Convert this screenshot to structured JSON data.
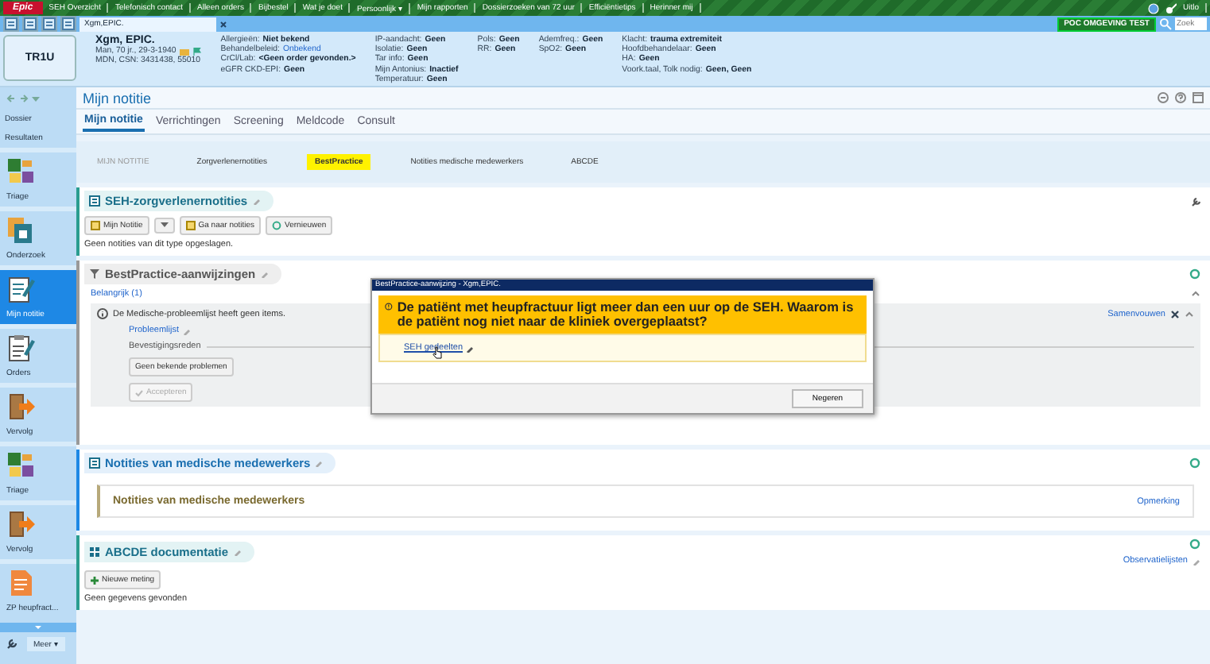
{
  "toolbar": {
    "logo": "Epic",
    "items": [
      "SEH Overzicht",
      "Telefonisch contact",
      "Alleen orders",
      "Bijbestel",
      "Wat je doet",
      "Persoonlijk ▾",
      "Mijn rapporten",
      "Dossierzoeken van 72 uur",
      "Efficiëntietips",
      "Herinner mij"
    ],
    "logout": "Uitlo"
  },
  "tabstrip": {
    "tabs": [
      {
        "label": "Xgm,EPIC.",
        "selected": true
      }
    ],
    "environment": "POC OMGEVING TEST",
    "search_placeholder": "Zoek"
  },
  "patient": {
    "bed": "TR1U",
    "name": "Xgm, EPIC.",
    "demographics": "Man, 70 jr., 29-3-1940",
    "ids": "MDN, CSN: 3431438, 55010",
    "columns": [
      [
        {
          "label": "Allergieën:",
          "value": "Niet bekend",
          "kind": "plain"
        },
        {
          "label": "Behandelbeleid:",
          "value": "Onbekend",
          "kind": "link"
        },
        {
          "label": "CrCl/Lab:",
          "value": "<Geen order gevonden.>",
          "kind": "plain"
        },
        {
          "label": "eGFR CKD-EPI:",
          "value": "Geen",
          "kind": "plain"
        }
      ],
      [
        {
          "label": "IP-aandacht:",
          "value": "Geen",
          "kind": "plain"
        },
        {
          "label": "Isolatie:",
          "value": "Geen",
          "kind": "plain"
        },
        {
          "label": "Tar info:",
          "value": "Geen",
          "kind": "plain"
        },
        {
          "label": "Mijn Antonius:",
          "value": "Inactief",
          "kind": "plain"
        },
        {
          "label": "Temperatuur:",
          "value": "Geen",
          "kind": "plain"
        }
      ],
      [
        {
          "label": "Pols:",
          "value": "Geen",
          "kind": "plain"
        },
        {
          "label": "RR:",
          "value": "Geen",
          "kind": "plain"
        }
      ],
      [
        {
          "label": "Ademfreq.:",
          "value": "Geen",
          "kind": "plain"
        },
        {
          "label": "SpO2:",
          "value": "Geen",
          "kind": "plain"
        }
      ],
      [
        {
          "label": "Klacht:",
          "value": "trauma extremiteit",
          "kind": "plain"
        },
        {
          "label": "Hoofdbehandelaar:",
          "value": "Geen",
          "kind": "plain"
        },
        {
          "label": "HA:",
          "value": "Geen",
          "kind": "plain"
        },
        {
          "label": "Voork.taal, Tolk nodig:",
          "value": "Geen, Geen",
          "kind": "plain"
        }
      ]
    ]
  },
  "sidebar": {
    "links": [
      "Dossier",
      "Resultaten"
    ],
    "items": [
      {
        "label": "Triage",
        "kind": "triage",
        "selected": false
      },
      {
        "label": "Onderzoek",
        "kind": "research",
        "selected": false
      },
      {
        "label": "Mijn notitie",
        "kind": "note",
        "selected": true
      },
      {
        "label": "Orders",
        "kind": "orders",
        "selected": false
      },
      {
        "label": "Vervolg",
        "kind": "exit",
        "selected": false
      },
      {
        "label": "Triage",
        "kind": "triage",
        "selected": false
      },
      {
        "label": "Vervolg",
        "kind": "exit",
        "selected": false
      },
      {
        "label": "ZP heupfract...",
        "kind": "document",
        "selected": false
      }
    ],
    "more": "Meer ▾"
  },
  "main": {
    "title": "Mijn notitie",
    "tabs": [
      {
        "label": "Mijn notitie",
        "selected": true
      },
      {
        "label": "Verrichtingen",
        "selected": false
      },
      {
        "label": "Screening",
        "selected": false
      },
      {
        "label": "Meldcode",
        "selected": false
      },
      {
        "label": "Consult",
        "selected": false
      }
    ],
    "jump_links": [
      {
        "label": "MIJN NOTITIE",
        "selected": false,
        "disabled": true
      },
      {
        "label": "Zorgverlenernotities",
        "selected": false,
        "disabled": false
      },
      {
        "label": "BestPractice",
        "selected": true,
        "disabled": false
      },
      {
        "label": "Notities medische medewerkers",
        "selected": false,
        "disabled": false
      },
      {
        "label": "ABCDE",
        "selected": false,
        "disabled": false
      }
    ],
    "sections": [
      {
        "kind": "notes",
        "title": "SEH-zorgverlenernotities",
        "buttons": [
          "Mijn Notitie",
          "Ga naar notities",
          "Vernieuwen"
        ],
        "message": "Geen notities van dit type opgeslagen."
      },
      {
        "kind": "bestpractice",
        "title": "BestPractice-aanwijzingen",
        "group": "Belangrijk (1)",
        "alert": "De Medische-probleemlijst heeft geen items.",
        "collapse": "Samenvouwen",
        "link": "Probleemlijst",
        "reason_label": "Bevestigingsreden",
        "buttons": [
          {
            "label": "Geen bekende problemen",
            "disabled": false
          },
          {
            "label": "Accepteren",
            "disabled": true
          }
        ]
      },
      {
        "kind": "staff",
        "title": "Notities van medische medewerkers",
        "inner_title": "Notities van medische medewerkers",
        "action": "Opmerking"
      },
      {
        "kind": "abcde",
        "title": "ABCDE documentatie",
        "button": "Nieuwe meting",
        "message": "Geen gegevens gevonden",
        "link": "Observatielijsten"
      }
    ]
  },
  "dialog": {
    "title": "BestPractice-aanwijzing - Xgm,EPIC.",
    "message": "De patiënt met heupfractuur ligt meer dan een uur op de SEH. Waarom is de patiënt nog niet naar de kliniek overgeplaatst?",
    "link": "SEH gedeelten",
    "button": "Negeren"
  }
}
